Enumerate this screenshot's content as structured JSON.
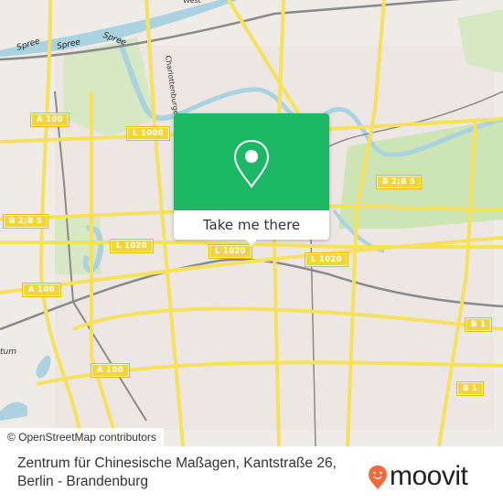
{
  "map": {
    "road_shields": [
      {
        "id": "a100-north",
        "label": "A 100"
      },
      {
        "id": "l1000",
        "label": "L 1000"
      },
      {
        "id": "b2b5-west",
        "label": "B 2;B 5"
      },
      {
        "id": "b2b5-east",
        "label": "B 2;B 5"
      },
      {
        "id": "l1020-west",
        "label": "L 1020"
      },
      {
        "id": "l1020-center",
        "label": "L 1020"
      },
      {
        "id": "l1020-east",
        "label": "L 1020"
      },
      {
        "id": "a100-west",
        "label": "A 100"
      },
      {
        "id": "a100-south",
        "label": "A 100"
      },
      {
        "id": "b1-north",
        "label": "B 1"
      },
      {
        "id": "b1-south",
        "label": "B 1"
      }
    ],
    "water_labels": [
      "Spree",
      "Spree",
      "Spree"
    ],
    "street_labels": [
      "Charlottenburger Verbindungskanal",
      "West",
      "tum"
    ],
    "colors": {
      "background": "#f0eeea",
      "major_road": "#f6e15c",
      "water": "#aad3df",
      "park": "#cde5b4",
      "rail": "#8a8a8a",
      "brand_green": "#1db866",
      "moovit_orange": "#f26a3b"
    }
  },
  "attribution": "© OpenStreetMap contributors",
  "popup": {
    "icon": "location-pin-icon",
    "cta_label": "Take me there"
  },
  "footer": {
    "address_line1": "Zentrum für Chinesische Maßagen, Kantstraße 26,",
    "address_line2": "Berlin - Brandenburg",
    "brand": "moovit"
  }
}
